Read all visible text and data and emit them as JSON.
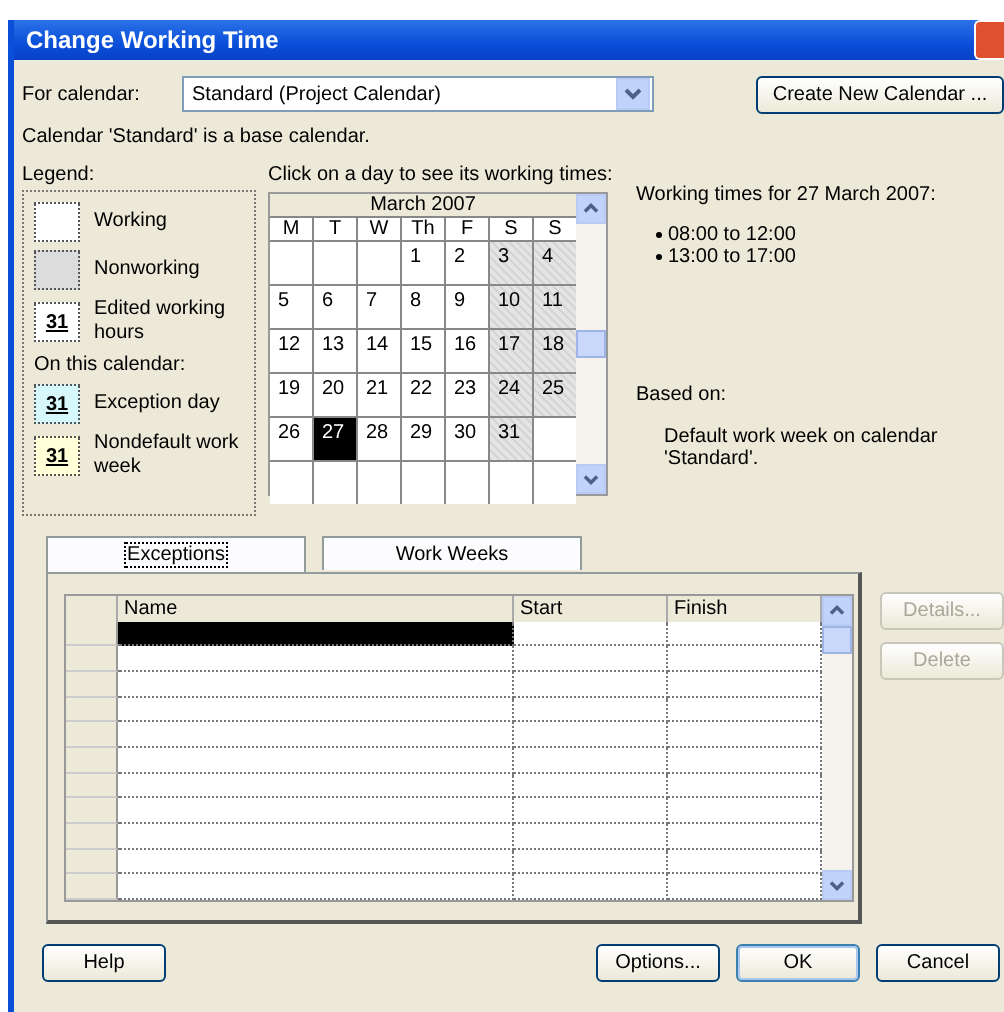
{
  "window": {
    "title": "Change Working Time"
  },
  "calendar_select": {
    "label": "For calendar:",
    "value": "Standard (Project Calendar)"
  },
  "create_button": "Create New Calendar ...",
  "info": "Calendar 'Standard' is a base calendar.",
  "legend": {
    "title": "Legend:",
    "subtitle": "On this calendar:",
    "items": [
      {
        "kind": "working",
        "label": "Working"
      },
      {
        "kind": "nonworking",
        "label": "Nonworking"
      },
      {
        "kind": "edited",
        "label": "Edited working hours",
        "mark": "31"
      },
      {
        "kind": "exception",
        "label": "Exception day",
        "mark": "31"
      },
      {
        "kind": "nondefault",
        "label": "Nondefault work week",
        "mark": "31"
      }
    ]
  },
  "calendar": {
    "prompt": "Click on a day to see its working times:",
    "month": "March 2007",
    "weekdays": [
      "M",
      "T",
      "W",
      "Th",
      "F",
      "S",
      "S"
    ],
    "weeks": [
      [
        {
          "nonworking": false,
          "selected": false
        },
        {
          "nonworking": false,
          "selected": false
        },
        {
          "nonworking": false,
          "selected": false
        },
        {
          "day": "1",
          "nonworking": false,
          "selected": false
        },
        {
          "day": "2",
          "nonworking": false,
          "selected": false
        },
        {
          "day": "3",
          "nonworking": true,
          "selected": false
        },
        {
          "day": "4",
          "nonworking": true,
          "selected": false
        }
      ],
      [
        {
          "day": "5",
          "nonworking": false,
          "selected": false
        },
        {
          "day": "6",
          "nonworking": false,
          "selected": false
        },
        {
          "day": "7",
          "nonworking": false,
          "selected": false
        },
        {
          "day": "8",
          "nonworking": false,
          "selected": false
        },
        {
          "day": "9",
          "nonworking": false,
          "selected": false
        },
        {
          "day": "10",
          "nonworking": true,
          "selected": false
        },
        {
          "day": "11",
          "nonworking": true,
          "selected": false
        }
      ],
      [
        {
          "day": "12",
          "nonworking": false,
          "selected": false
        },
        {
          "day": "13",
          "nonworking": false,
          "selected": false
        },
        {
          "day": "14",
          "nonworking": false,
          "selected": false
        },
        {
          "day": "15",
          "nonworking": false,
          "selected": false
        },
        {
          "day": "16",
          "nonworking": false,
          "selected": false
        },
        {
          "day": "17",
          "nonworking": true,
          "selected": false
        },
        {
          "day": "18",
          "nonworking": true,
          "selected": false
        }
      ],
      [
        {
          "day": "19",
          "nonworking": false,
          "selected": false
        },
        {
          "day": "20",
          "nonworking": false,
          "selected": false
        },
        {
          "day": "21",
          "nonworking": false,
          "selected": false
        },
        {
          "day": "22",
          "nonworking": false,
          "selected": false
        },
        {
          "day": "23",
          "nonworking": false,
          "selected": false
        },
        {
          "day": "24",
          "nonworking": true,
          "selected": false
        },
        {
          "day": "25",
          "nonworking": true,
          "selected": false
        }
      ],
      [
        {
          "day": "26",
          "nonworking": false,
          "selected": false
        },
        {
          "day": "27",
          "nonworking": false,
          "selected": true
        },
        {
          "day": "28",
          "nonworking": false,
          "selected": false
        },
        {
          "day": "29",
          "nonworking": false,
          "selected": false
        },
        {
          "day": "30",
          "nonworking": false,
          "selected": false
        },
        {
          "day": "31",
          "nonworking": true,
          "selected": false
        },
        {
          "nonworking": false,
          "selected": false
        }
      ],
      [
        {
          "nonworking": false,
          "selected": false
        },
        {
          "nonworking": false,
          "selected": false
        },
        {
          "nonworking": false,
          "selected": false
        },
        {
          "nonworking": false,
          "selected": false
        },
        {
          "nonworking": false,
          "selected": false
        },
        {
          "nonworking": false,
          "selected": false
        },
        {
          "nonworking": false,
          "selected": false
        }
      ]
    ]
  },
  "working_times": {
    "title": "Working times for 27 March 2007:",
    "times": [
      "08:00 to 12:00",
      "13:00 to 17:00"
    ],
    "based_on_label": "Based on:",
    "based_on": "Default work week on calendar 'Standard'."
  },
  "tabs": [
    {
      "label": "Exceptions",
      "selected": true
    },
    {
      "label": "Work Weeks",
      "selected": false
    }
  ],
  "table": {
    "columns": [
      "Name",
      "Start",
      "Finish"
    ],
    "rows": [
      {
        "selected": true
      },
      {
        "selected": false
      },
      {
        "selected": false
      },
      {
        "selected": false
      },
      {
        "selected": false
      },
      {
        "selected": false
      },
      {
        "selected": false
      },
      {
        "selected": false
      },
      {
        "selected": false
      },
      {
        "selected": false
      },
      {
        "selected": false
      }
    ]
  },
  "side_buttons": [
    {
      "label": "Details...",
      "disabled": true
    },
    {
      "label": "Delete",
      "disabled": true
    }
  ],
  "footer": {
    "help": "Help",
    "buttons": [
      "Options...",
      "OK",
      "Cancel"
    ]
  }
}
